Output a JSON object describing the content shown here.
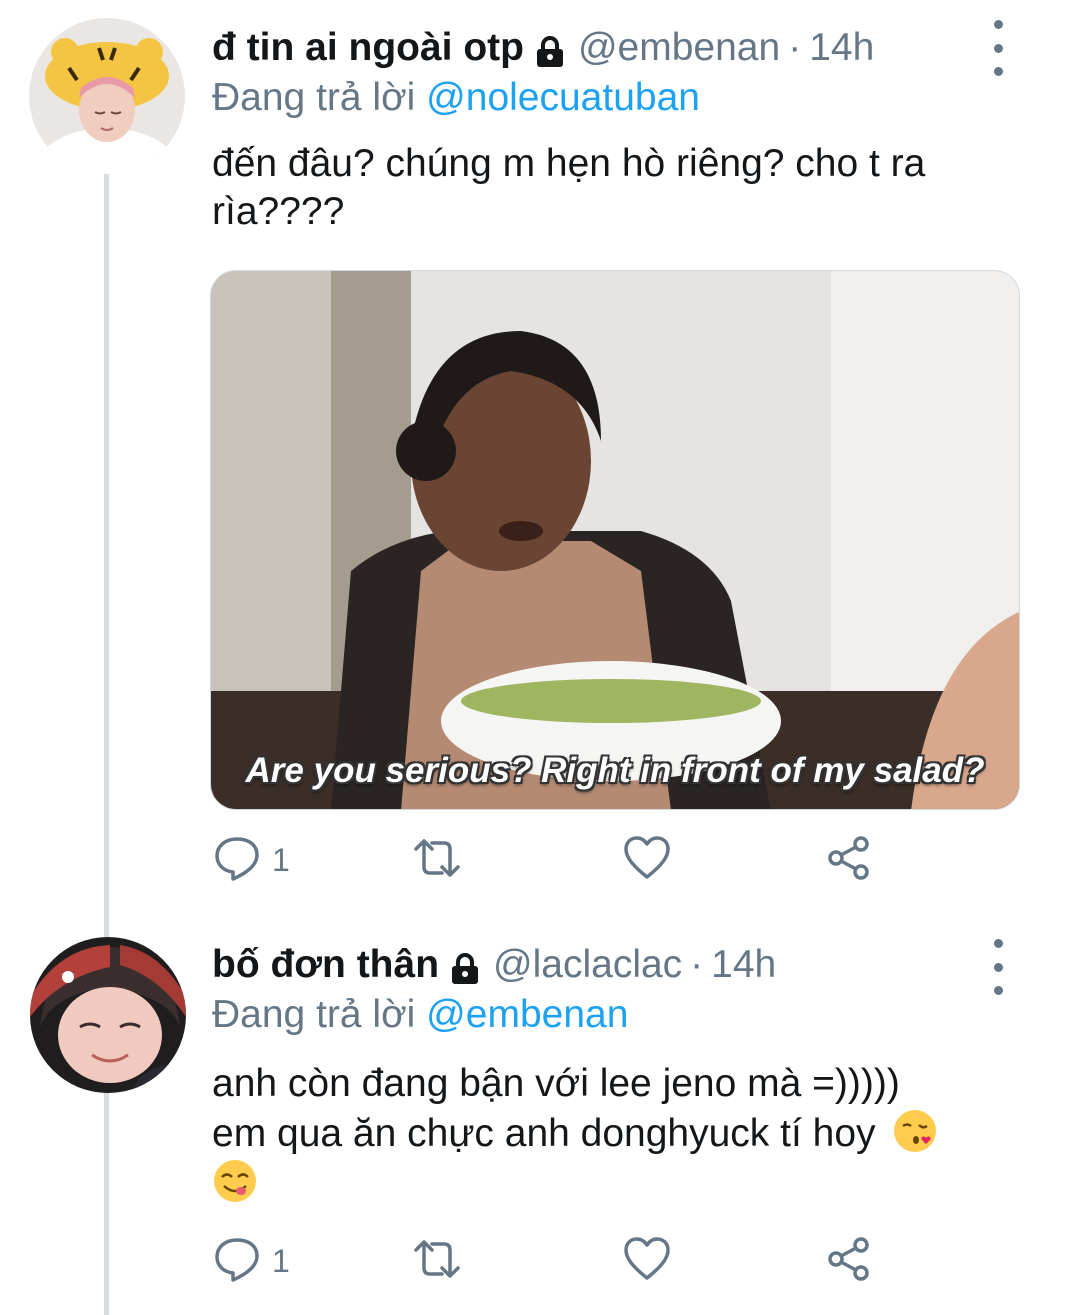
{
  "tweets": [
    {
      "name": "đ tin ai ngoài otp",
      "handle": "@embenan",
      "separator": "·",
      "time": "14h",
      "reply_prefix": "Đang trả lời",
      "reply_to": "@nolecuatuban",
      "text": "đến đâu? chúng m hẹn hò riêng? cho t ra rìa????",
      "media_caption": "Are you serious? Right in front of my salad?",
      "reply_count": "1",
      "icons": [
        "lock-icon",
        "more-icon",
        "reply-icon",
        "retweet-icon",
        "like-icon",
        "share-icon"
      ]
    },
    {
      "name": "bố đơn thân",
      "handle": "@laclaclac",
      "separator": "·",
      "time": "14h",
      "reply_prefix": "Đang trả lời",
      "reply_to": "@embenan",
      "text_line_1": "anh còn đang bận với lee jeno mà =)))))",
      "text_line_2": "em qua ăn chực anh donghyuck tí hoy",
      "emojis": [
        "face-blowing-kiss-emoji",
        "face-savoring-food-emoji"
      ],
      "reply_count": "1",
      "icons": [
        "lock-icon",
        "more-icon",
        "reply-icon",
        "retweet-icon",
        "like-icon",
        "share-icon"
      ]
    }
  ],
  "colors": {
    "text": "#14171a",
    "secondary": "#657786",
    "link": "#1da1f2",
    "thread_line": "#d9dde1"
  }
}
